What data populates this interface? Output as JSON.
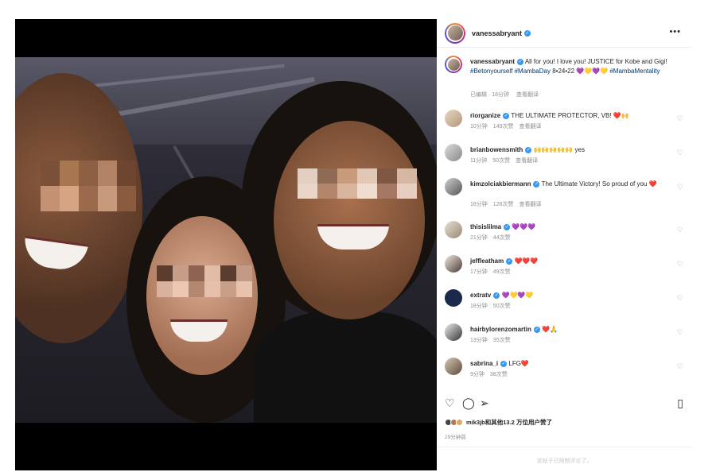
{
  "post": {
    "author": "vanessabryant",
    "menu_icon": "more-horizontal-icon"
  },
  "caption": {
    "username": "vanessabryant",
    "text": "All for you! I love you! JUSTICE for Kobe and Gigi!",
    "hashtags": "#Betonyourself #MambaDay",
    "date_text": "8•24•22",
    "hearts": "💜💛💜💛",
    "hashtag2": "#MambaMentality",
    "edited": "已编辑 · 18分钟",
    "translate": "查看翻译"
  },
  "comments": [
    {
      "user": "riorganize",
      "text": "THE ULTIMATE PROTECTOR, VB! ❤️🙌",
      "time": "10分钟",
      "likes": "149次赞",
      "reply": "查看翻译"
    },
    {
      "user": "brianbowensmith",
      "text": "🙌🙌🙌🙌🙌 yes",
      "time": "11分钟",
      "likes": "50次赞",
      "reply": "查看翻译"
    },
    {
      "user": "kimzolciakbiermann",
      "text": "The Ultimate Victory! So proud of you ❤️",
      "time": "18分钟",
      "likes": "126次赞",
      "reply": "查看翻译"
    },
    {
      "user": "thisislilma",
      "text": "💜💜💜",
      "time": "21分钟",
      "likes": "44次赞",
      "reply": ""
    },
    {
      "user": "jeffleatham",
      "text": "❤️❤️❤️",
      "time": "17分钟",
      "likes": "49次赞",
      "reply": ""
    },
    {
      "user": "extratv",
      "text": "💜💛💜💛",
      "time": "18分钟",
      "likes": "50次赞",
      "reply": ""
    },
    {
      "user": "hairbylorenzomartin",
      "text": "❤️🙏",
      "time": "13分钟",
      "likes": "35次赞",
      "reply": ""
    },
    {
      "user": "sabrina_i",
      "text": "LFG❤️",
      "time": "9分钟",
      "likes": "38次赞",
      "reply": ""
    }
  ],
  "actions": {
    "like_icon": "heart-icon",
    "comment_icon": "comment-icon",
    "share_icon": "send-icon",
    "save_icon": "bookmark-icon"
  },
  "likes_text": "mik3jb和其他13.2 万位用户赞了",
  "posted_time": "29分钟前",
  "footer_text": "该帖子已限制评论了。",
  "colors": {
    "verified": "#3897f0",
    "link": "#00376b",
    "muted": "#8e8e8e"
  }
}
